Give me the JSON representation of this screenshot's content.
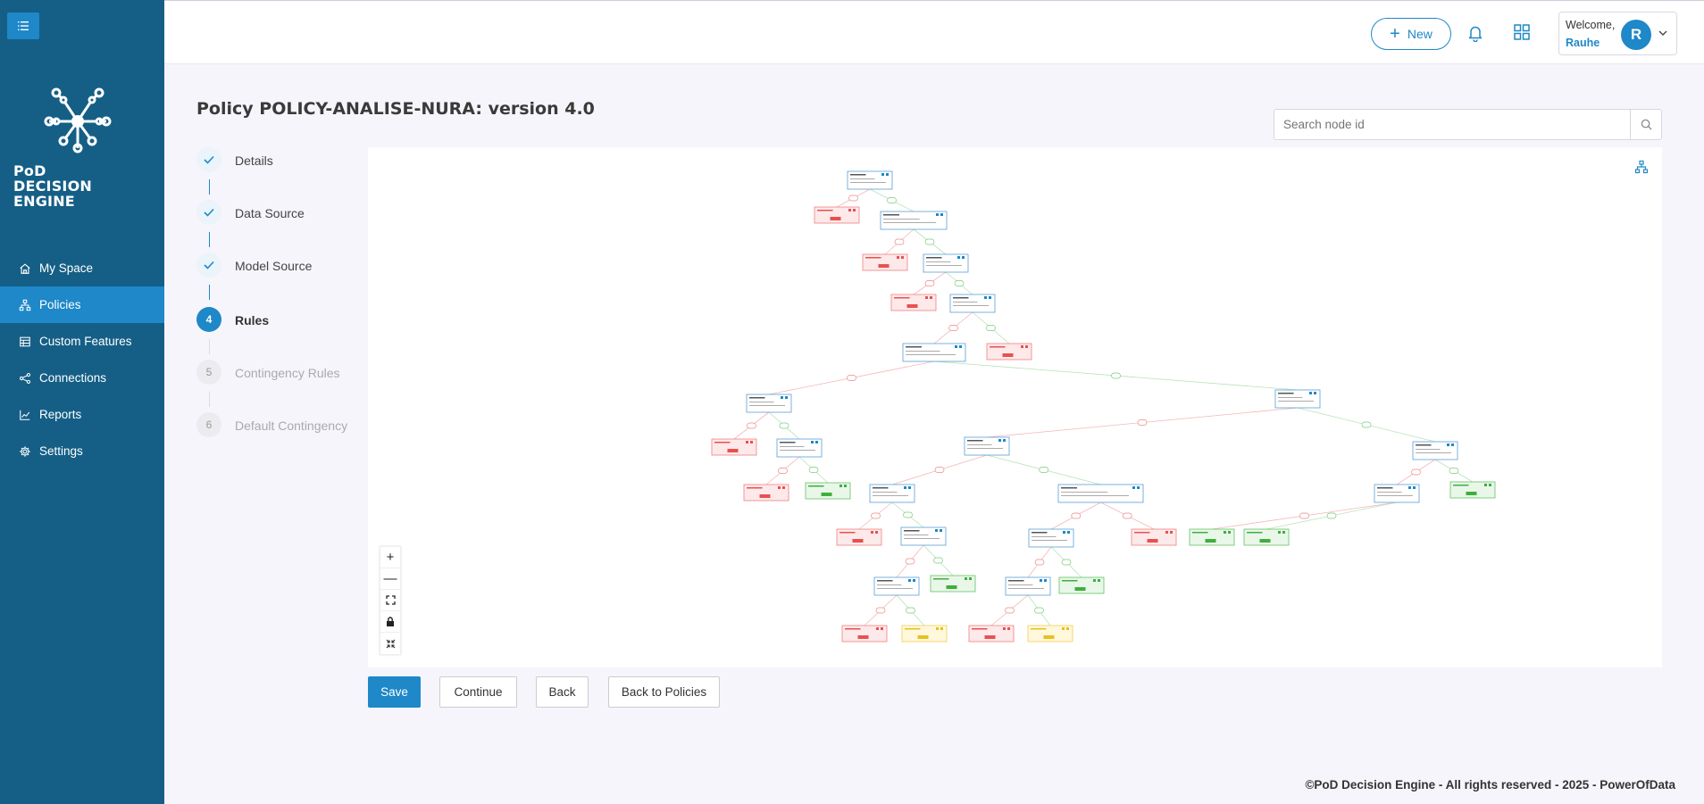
{
  "app": {
    "logo_lines": [
      "PoD",
      "DECISION",
      "ENGINE"
    ]
  },
  "sidebar": {
    "items": [
      {
        "label": "My Space",
        "icon": "home-icon",
        "active": false
      },
      {
        "label": "Policies",
        "icon": "hierarchy-icon",
        "active": true
      },
      {
        "label": "Custom Features",
        "icon": "table-icon",
        "active": false
      },
      {
        "label": "Connections",
        "icon": "share-icon",
        "active": false
      },
      {
        "label": "Reports",
        "icon": "chart-icon",
        "active": false
      },
      {
        "label": "Settings",
        "icon": "gear-icon",
        "active": false
      }
    ]
  },
  "header": {
    "new_label": "New",
    "welcome": "Welcome,",
    "username": "Rauhe",
    "avatar_initial": "R"
  },
  "page": {
    "title": "Policy POLICY-ANALISE-NURA: version 4.0",
    "search_placeholder": "Search node id"
  },
  "stepper": {
    "steps": [
      {
        "number": "1",
        "label": "Details",
        "state": "done"
      },
      {
        "number": "2",
        "label": "Data Source",
        "state": "done"
      },
      {
        "number": "3",
        "label": "Model Source",
        "state": "done"
      },
      {
        "number": "4",
        "label": "Rules",
        "state": "current"
      },
      {
        "number": "5",
        "label": "Contingency Rules",
        "state": "todo"
      },
      {
        "number": "6",
        "label": "Default Contingency",
        "state": "todo"
      }
    ]
  },
  "zoom_controls": {
    "zoom_in": "+",
    "zoom_out": "—"
  },
  "actions": {
    "save": "Save",
    "continue": "Continue",
    "back": "Back",
    "back_to_policies": "Back to Policies"
  },
  "footer": {
    "text": "©PoD Decision Engine - All rights reserved - 2025 - PowerOfData"
  },
  "colors": {
    "sidebar_bg": "#155f86",
    "accent": "#1e88c8",
    "node_condition": "#5a9fd4",
    "node_deny": "#f08080",
    "node_approve": "#66c266",
    "node_review": "#f0d050"
  }
}
